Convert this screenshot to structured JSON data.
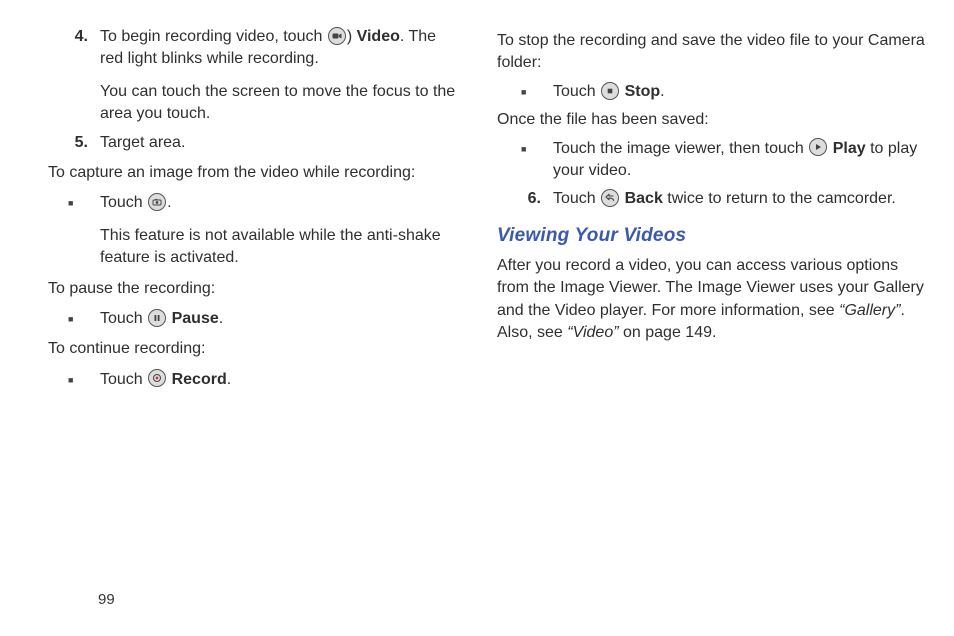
{
  "page_number": "99",
  "left": {
    "item4": {
      "num": "4.",
      "p1a": "To begin recording video, touch ",
      "p1b_close": ") ",
      "p1b_bold": "Video",
      "p1c": ". The red light blinks while recording.",
      "p2": "You can touch the screen to move the focus to the area you touch."
    },
    "item5": {
      "num": "5.",
      "text": "Target area."
    },
    "capture_intro": "To capture an image from the video while recording:",
    "capture_b1a": "Touch ",
    "capture_b1b": ".",
    "capture_b1_sub": "This feature is not available while the anti-shake feature is activated.",
    "pause_intro": "To pause the recording:",
    "pause_b1a": "Touch ",
    "pause_b1_bold": "Pause",
    "pause_b1b": ".",
    "continue_intro": "To continue recording:",
    "continue_b1a": "Touch ",
    "continue_b1_bold": "Record",
    "continue_b1b": "."
  },
  "right": {
    "stop_intro": "To stop the recording and save the video file to your Camera folder:",
    "stop_b1a": "Touch ",
    "stop_b1_bold": "Stop",
    "stop_b1b": ".",
    "saved_intro": "Once the file has been saved:",
    "play_b1a": "Touch the image viewer, then touch ",
    "play_b1_bold": "Play",
    "play_b1b": " to play your video.",
    "item6": {
      "num": "6.",
      "a": "Touch ",
      "bold": "Back",
      "b": " twice to return to the camcorder."
    },
    "heading": "Viewing Your Videos",
    "para_a": "After you record a video, you can access various options from the Image Viewer. The Image Viewer uses your Gallery and the Video player. For more information, see ",
    "para_gallery": "“Gallery”",
    "para_b": ". Also, see ",
    "para_video": "“Video”",
    "para_c": " on page 149."
  }
}
